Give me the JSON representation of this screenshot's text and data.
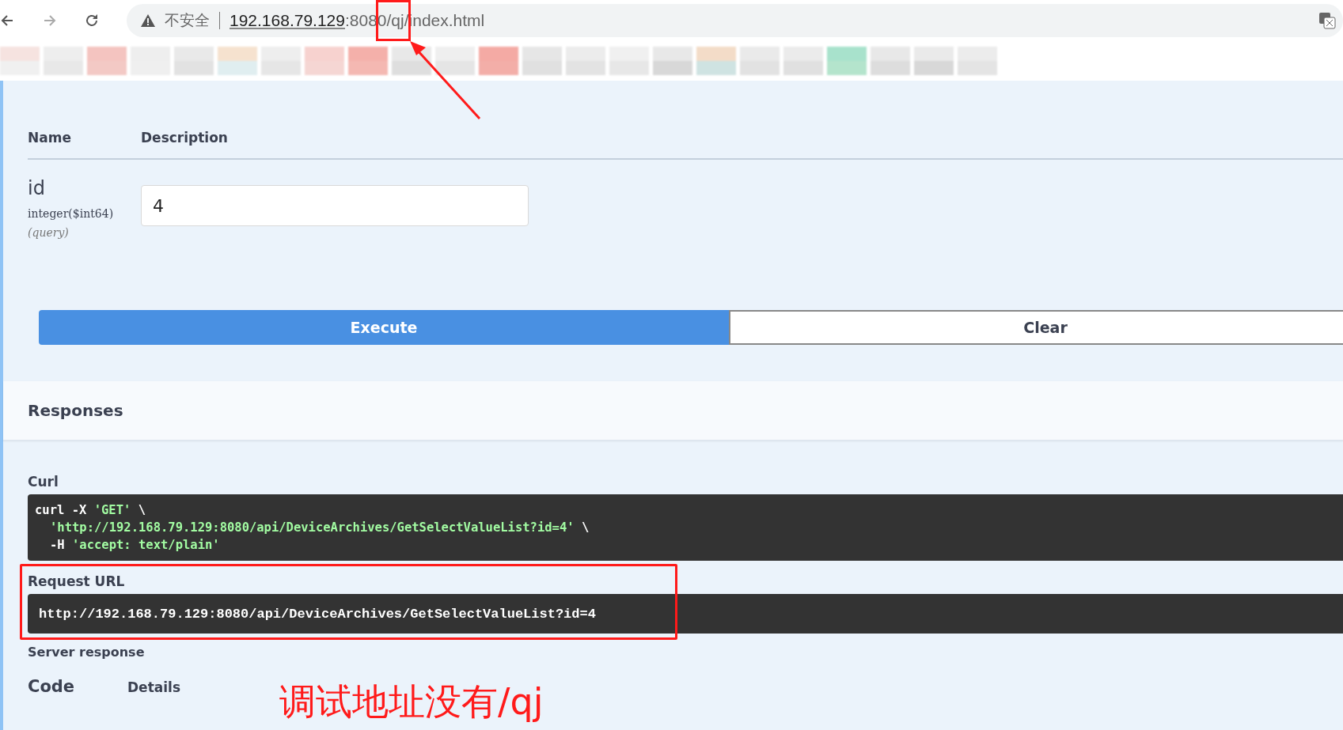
{
  "browser": {
    "security_label": "不安全",
    "url_host": "192.168.79.129",
    "url_rest": ":8080/qj/index.html"
  },
  "parameters": {
    "columns": [
      "Name",
      "Description"
    ],
    "rows": [
      {
        "name": "id",
        "type": "integer",
        "format": "($int64)",
        "location": "(query)",
        "value": "4"
      }
    ]
  },
  "buttons": [
    {
      "label": "Execute",
      "kind": "primary"
    },
    {
      "label": "Clear",
      "kind": "secondary"
    }
  ],
  "responses": {
    "title": "Responses",
    "curl_label": "Curl",
    "curl_lines": [
      [
        {
          "kind": "plain",
          "text": "curl -X "
        },
        {
          "kind": "string",
          "text": "'GET'"
        },
        {
          "kind": "plain",
          "text": " \\"
        }
      ],
      [
        {
          "kind": "string",
          "text": "'http://192.168.79.129:8080/api/DeviceArchives/GetSelectValueList?id=4'"
        },
        {
          "kind": "plain",
          "text": " \\"
        }
      ],
      [
        {
          "kind": "plain",
          "text": "-H "
        },
        {
          "kind": "string",
          "text": "'accept: text/plain'"
        }
      ]
    ],
    "request_url_label": "Request URL",
    "request_url": "http://192.168.79.129:8080/api/DeviceArchives/GetSelectValueList?id=4",
    "server_response_label": "Server response",
    "columns": [
      "Code",
      "Details"
    ]
  },
  "annotation": {
    "caption": "调试地址没有/qj"
  }
}
